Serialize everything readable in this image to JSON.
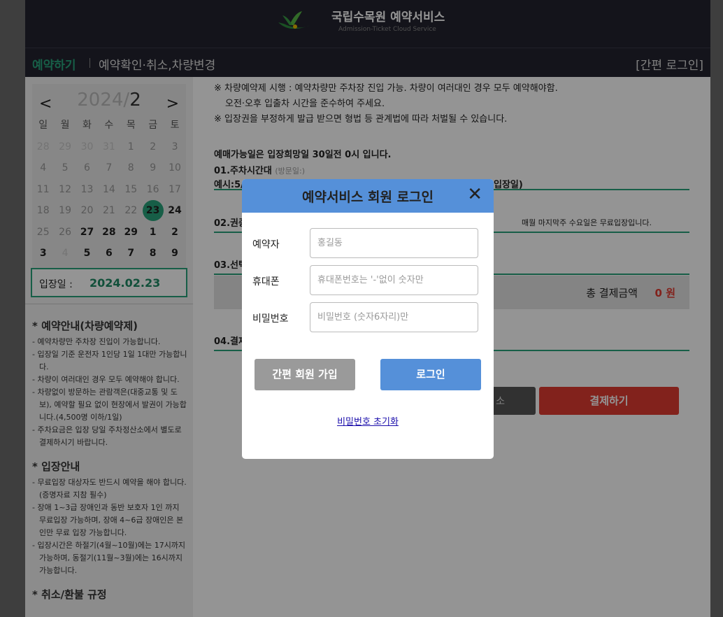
{
  "header": {
    "title": "국립수목원 예약서비스",
    "subtitle": "Admission-Ticket Cloud Service"
  },
  "nav": {
    "book": "예약하기",
    "check": "예약확인·취소,차량변경",
    "login": "[간편 로그인]"
  },
  "calendar": {
    "prev": "<",
    "next": ">",
    "year": "2024/",
    "month": "2",
    "weekdays": [
      "일",
      "월",
      "화",
      "수",
      "목",
      "금",
      "토"
    ],
    "rows": [
      [
        "28",
        "29",
        "30",
        "31",
        "1",
        "2",
        "3"
      ],
      [
        "4",
        "5",
        "6",
        "7",
        "8",
        "9",
        "10"
      ],
      [
        "11",
        "12",
        "13",
        "14",
        "15",
        "16",
        "17"
      ],
      [
        "18",
        "19",
        "20",
        "21",
        "22",
        "23",
        "24"
      ],
      [
        "25",
        "26",
        "27",
        "28",
        "29",
        "1",
        "2"
      ],
      [
        "3",
        "4",
        "5",
        "6",
        "7",
        "8",
        "9"
      ]
    ]
  },
  "entry": {
    "label": "입장일 :",
    "value": "2024.02.23"
  },
  "notice": {
    "s1_title": "* 예약안내(차량예약제)",
    "s1": [
      "- 예약차량만 주차장 진입이 가능합니다.",
      "- 입장일 기준 운전자 1인당 1일 1대만 가능합니다.",
      "- 차량이 여러대인 경우 모두 예약해야 합니다.",
      "- 차량없이 방문하는 관람객은(대중교통 및 도보), 예약할 필요 없이 현장에서 발권이 가능합니다.(4,500명 이하/1일)",
      "- 주차요금은 입장 당일 주차정산소에서 별도로 결제하시기 바랍니다."
    ],
    "s2_title": "* 입장안내",
    "s2": [
      "- 무료입장 대상자도 반드시 예약을 해야 합니다. (증명자료 지참 필수)",
      "- 장애 1~3급 장애인과 동반 보호자 1인 까지 무료입장 가능하며, 장애 4~6급 장애인은 본인만 무료 입장 가능합니다.",
      "- 입장시간은 하절기(4월~10월)에는 17시까지 가능하며, 동절기(11월~3월)에는 16시까지 가능합니다."
    ],
    "s3_title": "* 취소/환불 규정"
  },
  "main": {
    "line1": "※ 차량예약제 시행 : 예약차량만 주차장 진입 가능. 차량이 여러대인 경우 모두 예약해야함.",
    "line2": "오전·오후 입출차 시간을 준수하여 주세요.",
    "line3": "※ 입장권을 부정하게 발급 받으면 형법 등 관계법에 따라 처벌될 수 있습니다.",
    "sale": "예매가능일은 입장희망일 30일전 0시 입니다.",
    "sec1": "01.주차시간대",
    "sec1_hint": "(방문일:)",
    "example": "예시:5/",
    "example_tail": "1(입장일)",
    "sec2": "02.권종",
    "free_note": "매월 마지막주 수요일은 무료입장입니다.",
    "sec3": "03.선택",
    "total_label": "총 결제금액",
    "total_value": "0 원",
    "sec4": "04.결제",
    "cancel": "소",
    "pay": "결제하기"
  },
  "modal": {
    "title": "예약서비스 회원 로그인",
    "close": "✕",
    "name_label": "예약자",
    "name_placeholder": "홍길동",
    "phone_label": "휴대폰",
    "phone_placeholder": "휴대폰번호는 '-'없이 숫자만",
    "pw_label": "비밀번호",
    "pw_placeholder": "비밀번호 (숫자6자리)만",
    "join": "간편 회원 가입",
    "login": "로그인",
    "reset": "비밀번호 초기화"
  },
  "colors": {
    "accent": "#28a37a",
    "modal_blue": "#5590d9",
    "pay_red": "#e03c31"
  }
}
